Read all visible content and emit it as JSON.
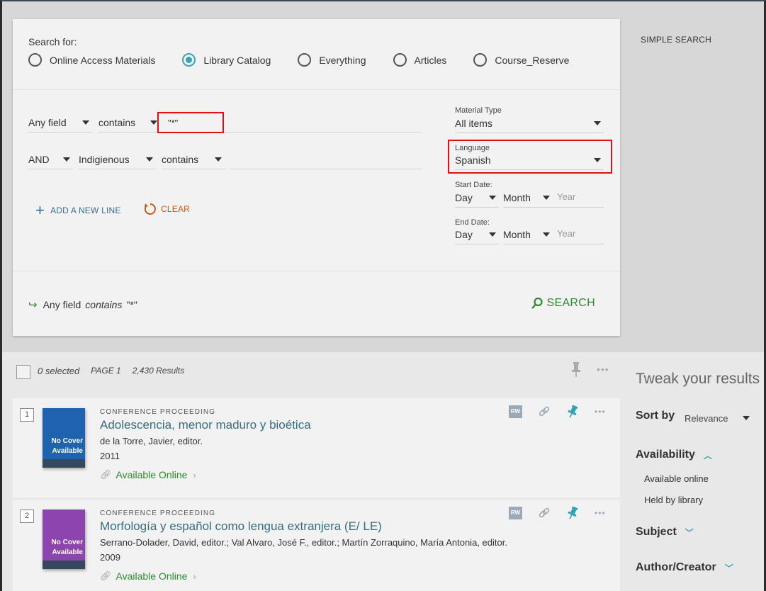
{
  "header": {
    "simple_search_label": "SIMPLE SEARCH"
  },
  "search_form": {
    "search_for_label": "Search for:",
    "scopes": [
      {
        "label": "Online Access Materials",
        "selected": false
      },
      {
        "label": "Library Catalog",
        "selected": true
      },
      {
        "label": "Everything",
        "selected": false
      },
      {
        "label": "Articles",
        "selected": false
      },
      {
        "label": "Course_Reserve",
        "selected": false
      }
    ],
    "line1": {
      "field": "Any field",
      "operator": "contains",
      "value": "\"*\""
    },
    "line2": {
      "boolean": "AND",
      "field": "Indigienous",
      "operator": "contains",
      "value": ""
    },
    "add_line_label": "ADD A NEW LINE",
    "clear_label": "CLEAR",
    "material_type": {
      "label": "Material Type",
      "value": "All items"
    },
    "language": {
      "label": "Language",
      "value": "Spanish"
    },
    "start_date": {
      "label": "Start Date:",
      "day": "Day",
      "month": "Month",
      "year_placeholder": "Year"
    },
    "end_date": {
      "label": "End Date:",
      "day": "Day",
      "month": "Month",
      "year_placeholder": "Year"
    },
    "summary": {
      "field": "Any field",
      "operator": "contains",
      "value": "\"*\""
    },
    "search_button_label": "SEARCH"
  },
  "results_toolbar": {
    "selected": "0 selected",
    "page": "PAGE 1",
    "count": "2,430 Results"
  },
  "results": [
    {
      "number": "1",
      "cover_text_1": "No Cover",
      "cover_text_2": "Available",
      "cover_color": "#1d63ad",
      "type": "CONFERENCE PROCEEDING",
      "title": "Adolescencia, menor maduro y bioética",
      "author": "de la Torre, Javier, editor.",
      "year": "2011",
      "availability": "Available Online",
      "rw_label": "RW"
    },
    {
      "number": "2",
      "cover_text_1": "No Cover",
      "cover_text_2": "Available",
      "cover_color": "#8e44ad",
      "type": "CONFERENCE PROCEEDING",
      "title": "Morfología y español como lengua extranjera (E/ LE)",
      "author": "Serrano-Dolader, David, editor.; Val Alvaro, José F., editor.; Martín Zorraquino, María Antonia, editor.",
      "year": "2009",
      "availability": "Available Online",
      "rw_label": "RW"
    }
  ],
  "sidebar": {
    "title": "Tweak your results",
    "sort_label": "Sort by",
    "sort_value": "Relevance",
    "facets": [
      {
        "label": "Availability",
        "expanded": true,
        "options": [
          "Available online",
          "Held by library"
        ]
      },
      {
        "label": "Subject",
        "expanded": false
      },
      {
        "label": "Author/Creator",
        "expanded": false
      }
    ]
  },
  "colors": {
    "accent_teal": "#3aa3b5",
    "success_green": "#2e8b2e",
    "clear_orange": "#c65a1a",
    "highlight_red": "#e01010",
    "title_link": "#366e7e"
  }
}
